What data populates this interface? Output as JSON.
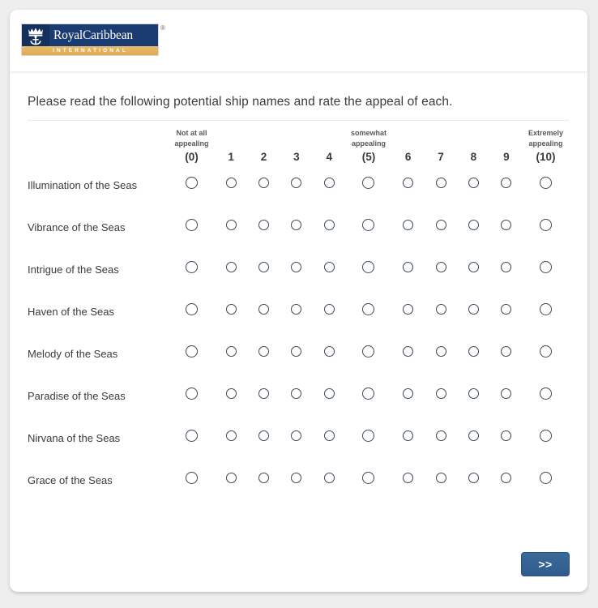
{
  "brand": {
    "logo_primary": "RoyalCaribbean",
    "logo_secondary": "INTERNATIONAL",
    "registered_mark": "®",
    "logo_bg": "#1b3c73",
    "logo_band": "#e1ab4f"
  },
  "survey": {
    "question": "Please read the following potential ship names and rate the appeal of each.",
    "scale_headers": [
      {
        "words": [
          "Not at all",
          "appealing"
        ],
        "number": "(0)",
        "anchor": true
      },
      {
        "words": [],
        "number": "1",
        "anchor": false
      },
      {
        "words": [],
        "number": "2",
        "anchor": false
      },
      {
        "words": [],
        "number": "3",
        "anchor": false
      },
      {
        "words": [],
        "number": "4",
        "anchor": false
      },
      {
        "words": [
          "somewhat",
          "appealing"
        ],
        "number": "(5)",
        "anchor": true
      },
      {
        "words": [],
        "number": "6",
        "anchor": false
      },
      {
        "words": [],
        "number": "7",
        "anchor": false
      },
      {
        "words": [],
        "number": "8",
        "anchor": false
      },
      {
        "words": [],
        "number": "9",
        "anchor": false
      },
      {
        "words": [
          "Extremely",
          "appealing"
        ],
        "number": "(10)",
        "anchor": true
      }
    ],
    "rows": [
      {
        "label": "Illumination of the Seas",
        "selected": null
      },
      {
        "label": "Vibrance of the Seas",
        "selected": null
      },
      {
        "label": "Intrigue of the Seas",
        "selected": null
      },
      {
        "label": "Haven of the Seas",
        "selected": null
      },
      {
        "label": "Melody of the Seas",
        "selected": null
      },
      {
        "label": "Paradise of the Seas",
        "selected": null
      },
      {
        "label": "Nirvana of the Seas",
        "selected": null
      },
      {
        "label": "Grace of the Seas",
        "selected": null
      }
    ]
  },
  "footer": {
    "next_label": ">>",
    "next_color": "#33618f"
  }
}
